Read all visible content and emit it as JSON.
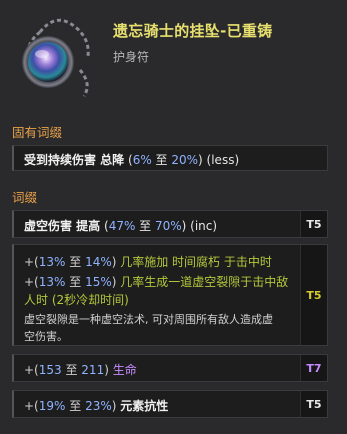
{
  "item": {
    "name": "遗忘骑士的挂坠-已重铸",
    "type": "护身符"
  },
  "implicit": {
    "header": "固有词缀",
    "text_bold": "受到持续伤害 总降",
    "open": " (",
    "min": "6%",
    "to": " 至 ",
    "max": "20%",
    "close": ") (less)"
  },
  "affix_header": "词缀",
  "affixes": [
    {
      "bold": "虚空伤害 提高",
      "open": " (",
      "min": "47%",
      "to": " 至 ",
      "max": "70%",
      "close": ") (inc)",
      "tier": "T5"
    },
    {
      "line1_prefix": "+(",
      "line1_min": "13%",
      "line1_to": " 至 ",
      "line1_max": "14%",
      "line1_close": ") ",
      "line1_text": "几率施加 时间腐朽 于击中时",
      "line2_prefix": "+(",
      "line2_min": "13%",
      "line2_to": " 至 ",
      "line2_max": "15%",
      "line2_close": ") ",
      "line2_text": "几率生成一道虚空裂隙于击中敌",
      "line3_text": "人时 (2秒冷却时间)",
      "desc1": "虚空裂隙是一种虚空法术, 可对周围所有敌人造成虚",
      "desc2": "空伤害。",
      "tier": "T5"
    },
    {
      "prefix": "+(",
      "min": "153",
      "to": " 至 ",
      "max": "211",
      "close": ") ",
      "text": "生命",
      "tier": "T7"
    },
    {
      "prefix": "+(",
      "min": "19%",
      "to": " 至 ",
      "max": "23%",
      "close": ") ",
      "text": "元素抗性",
      "tier": "T5"
    }
  ],
  "colors": {
    "title": "#e7e06f",
    "section": "#e9a24a",
    "number": "#8fb3ff",
    "green_text": "#b4c83a",
    "purple_text": "#c58cff"
  }
}
